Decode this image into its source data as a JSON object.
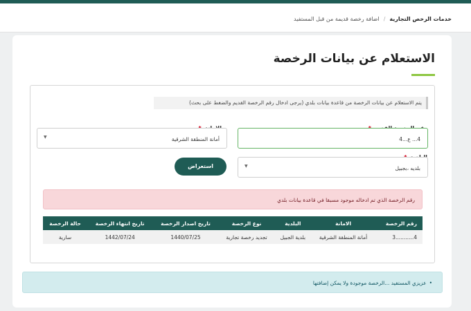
{
  "breadcrumb": {
    "root": "خدمات الرخص التجارية",
    "separator": "/",
    "current": "اضافة رخصة قديمة من قبل المستفيد"
  },
  "page": {
    "title": "الاستعلام عن بيانات الرخصة"
  },
  "info_note": "يتم الاستعلام عن بيانات الرخصة من قاعدة بيانات بلدي (يرجى ادخال رقم الرخصة القديم والضغط على بحث)",
  "form": {
    "old_license_label": "رقم الرخصة القديم",
    "old_license_value": "4... ع...4",
    "amana_label": "الامانة",
    "amana_value": "أمانة المنطقة الشرقية",
    "baladiya_label": "البلدية",
    "baladiya_value": "بلديه ،بجبيل",
    "required_mark": "*",
    "query_button": "استعراض"
  },
  "alerts": {
    "error": "رقم الرخصة الذي تم ادخاله موجود مسبقا في قاعدة بيانات بلدي",
    "info": "عزيزي المستفيد ...الرخصة موجودة ولا يمكن إضافتها"
  },
  "table": {
    "headers": [
      "رقم الرخصة",
      "الامانة",
      "البلدية",
      "نوع الرخصة",
      "تاريخ اصدار الرخصة",
      "تاريخ انتهاء الرخصة",
      "حالة الرخصة"
    ],
    "rows": [
      [
        "4...........3",
        "أمانة المنطقة الشرقية",
        "بلدية الجبيل",
        "تجديد رخصة تجارية",
        "1440/07/25",
        "1442/07/24",
        "سارية"
      ]
    ]
  },
  "colors": {
    "primary": "#1f5c55",
    "accent": "#8cc63f",
    "error_bg": "#f8d7da",
    "info_bg": "#d3ecee",
    "required": "#d0021b"
  }
}
